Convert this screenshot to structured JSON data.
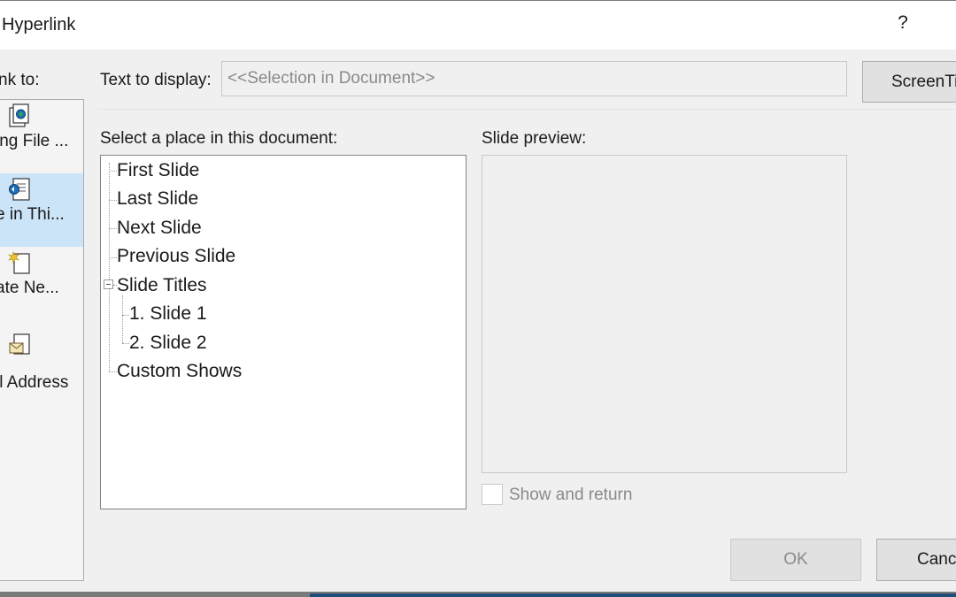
{
  "window": {
    "title": "Hyperlink",
    "help_label": "?"
  },
  "link_to": {
    "label_html": "nk to:",
    "items": [
      {
        "label": "ing File ...",
        "icon": "existing-file-icon",
        "selected": false
      },
      {
        "label": "e in Thi...",
        "icon": "place-in-document-icon",
        "selected": true
      },
      {
        "label": "ate Ne...",
        "icon": "create-new-document-icon",
        "selected": false
      },
      {
        "label": "il Address",
        "icon": "email-address-icon",
        "selected": false
      }
    ]
  },
  "text_to_display": {
    "label": "Text to display:",
    "value": "<<Selection in Document>>"
  },
  "screentip_button": "ScreenTip...",
  "place": {
    "label": "Select a place in this document:",
    "items": [
      {
        "label": "First Slide",
        "level": 0
      },
      {
        "label": "Last Slide",
        "level": 0
      },
      {
        "label": "Next Slide",
        "level": 0
      },
      {
        "label": "Previous Slide",
        "level": 0
      },
      {
        "label": "Slide Titles",
        "level": 0,
        "expanded": true
      },
      {
        "label": "1. Slide 1",
        "level": 1
      },
      {
        "label": "2. Slide 2",
        "level": 1
      },
      {
        "label": "Custom Shows",
        "level": 0
      }
    ]
  },
  "preview": {
    "label": "Slide preview:",
    "show_and_return": "Show and return",
    "checked": false
  },
  "buttons": {
    "ok": "OK",
    "cancel": "Cancel"
  },
  "colors": {
    "selected_bg": "#cce4f7",
    "dialog_bg": "#f0f0f0",
    "disabled_text": "#8a8a8a"
  }
}
